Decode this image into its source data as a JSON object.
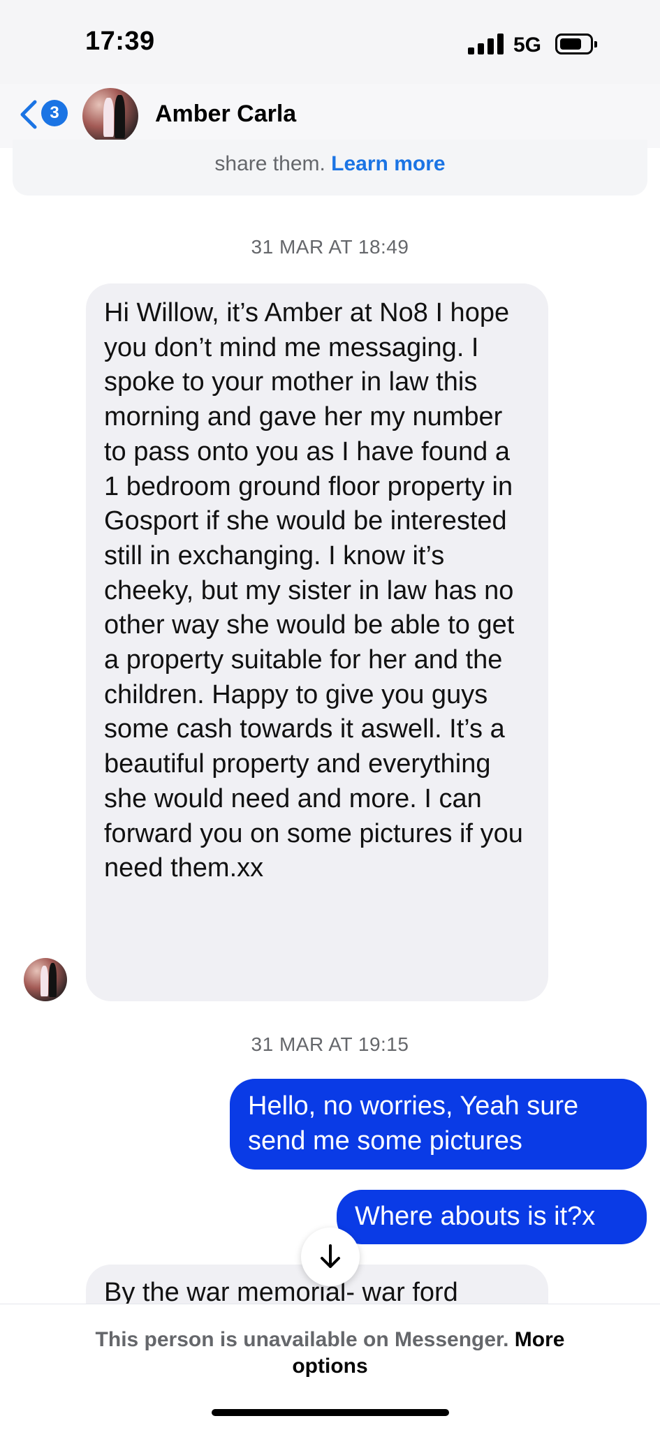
{
  "status_bar": {
    "time": "17:39",
    "network": "5G"
  },
  "header": {
    "badge_count": "3",
    "contact_name": "Amber Carla"
  },
  "notice": {
    "text": "share them. ",
    "link": "Learn more"
  },
  "messages": [
    {
      "timestamp": "31 MAR AT 18:49"
    },
    {
      "direction": "incoming",
      "text": "Hi Willow, it’s Amber at No8 I hope you don’t mind me messaging. I spoke to your mother in law this morning and gave her my number to pass onto you as I have found a 1 bedroom ground floor property in Gosport if she would be interested still in exchanging. I know it’s cheeky, but my sister in law has no other way she would be able to get a property suitable for her and the children. Happy to give you guys some cash towards it aswell. It’s a beautiful property and everything she would need and more. I can forward you on some pictures if you need them.xx"
    },
    {
      "timestamp": "31 MAR AT 19:15"
    },
    {
      "direction": "outgoing",
      "text": "Hello, no worries, Yeah sure send me some pictures"
    },
    {
      "direction": "outgoing",
      "text": "Where abouts is it?x"
    },
    {
      "direction": "incoming",
      "text": "By the war memorial- war ford"
    }
  ],
  "footer": {
    "text": "This person is unavailable on Messenger. ",
    "link": "More options"
  },
  "colors": {
    "accent": "#1b74e4",
    "outgoing_bubble": "#0a3be6",
    "incoming_bubble": "#f0f0f4",
    "muted_text": "#65676b"
  },
  "icons": {
    "back": "chevron-left-icon",
    "scroll": "arrow-down-icon",
    "signal": "signal-icon",
    "battery": "battery-icon"
  }
}
